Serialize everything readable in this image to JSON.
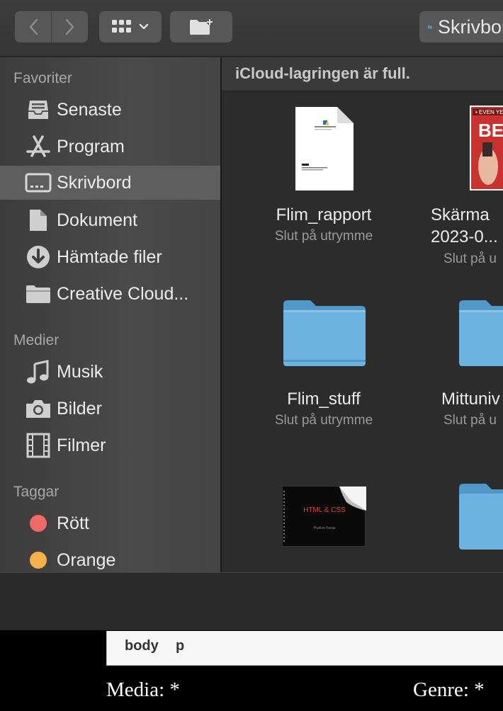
{
  "colors": {
    "tag_red": "#ef6a64",
    "tag_orange": "#f5b04a",
    "folder_blue": "#5aa6d6"
  },
  "toolbar": {
    "back_icon": "chevron-left-icon",
    "forward_icon": "chevron-right-icon",
    "view_icon": "icon-grid-icon",
    "new_folder_icon": "new-folder-icon",
    "location_label": "Skrivbord"
  },
  "sidebar": {
    "favorites_title": "Favoriter",
    "favorites": [
      {
        "label": "Senaste",
        "icon": "clock-tray-icon"
      },
      {
        "label": "Program",
        "icon": "app-store-icon"
      },
      {
        "label": "Skrivbord",
        "icon": "desktop-icon",
        "selected": true
      },
      {
        "label": "Dokument",
        "icon": "document-icon"
      },
      {
        "label": "Hämtade filer",
        "icon": "download-icon"
      },
      {
        "label": "Creative Cloud...",
        "icon": "folder-icon"
      }
    ],
    "media_title": "Medier",
    "media": [
      {
        "label": "Musik",
        "icon": "music-note-icon"
      },
      {
        "label": "Bilder",
        "icon": "camera-icon"
      },
      {
        "label": "Filmer",
        "icon": "film-icon"
      }
    ],
    "tags_title": "Taggar",
    "tags": [
      {
        "label": "Rött",
        "color": "#ef6a64"
      },
      {
        "label": "Orange",
        "color": "#f5b04a"
      }
    ]
  },
  "content": {
    "banner": "iCloud-lagringen är full.",
    "files": [
      {
        "name": "Flim_rapport",
        "status": "Slut på utrymme",
        "type": "document"
      },
      {
        "name": "Skärma",
        "name2": "2023-0...",
        "status": "Slut på u",
        "type": "image"
      },
      {
        "name": "Flim_stuff",
        "status": "Slut på utrymme",
        "type": "folder"
      },
      {
        "name": "Mittuniv",
        "status": "Slut på u",
        "type": "folder"
      },
      {
        "name": "",
        "type": "presentation",
        "thumb_title": "HTML & CSS",
        "thumb_sub": "Pusilon Ferqu"
      },
      {
        "name": "",
        "type": "folder"
      }
    ],
    "doc_thumb_title": "Flim"
  },
  "page": {
    "crumbs": [
      "body",
      "p"
    ],
    "media_label": "Media: *",
    "genre_label": "Genre: *"
  }
}
